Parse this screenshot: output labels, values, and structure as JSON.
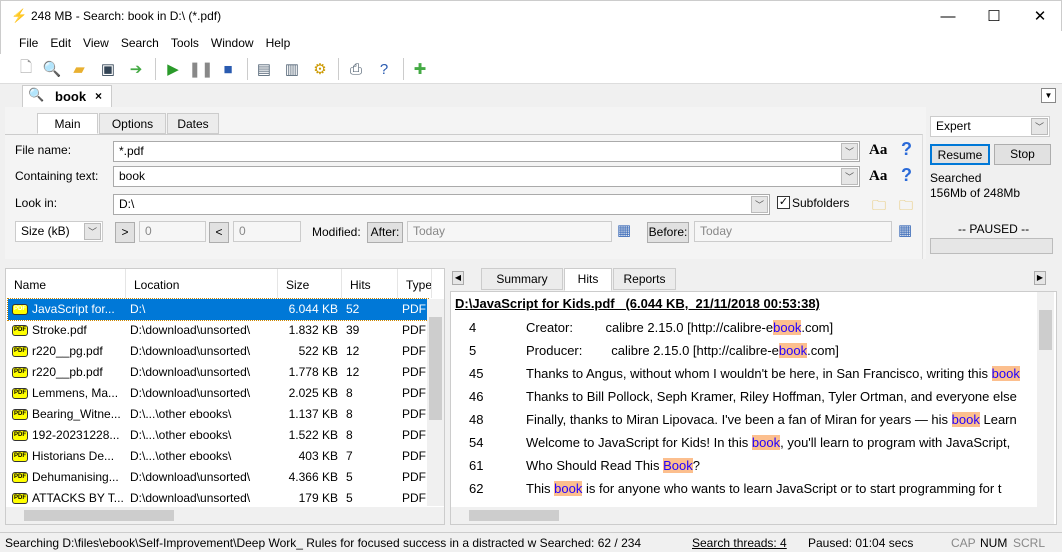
{
  "window": {
    "title": "248 MB - Search: book in D:\\ (*.pdf)",
    "minimize": "—",
    "maximize": "☐",
    "close": "✕"
  },
  "menu": [
    "File",
    "Edit",
    "View",
    "Search",
    "Tools",
    "Window",
    "Help"
  ],
  "toolbar": [
    "new-icon",
    "open-search-icon",
    "open-folder-icon",
    "save-icon",
    "export-icon",
    "start-icon",
    "pause-icon",
    "stop-icon",
    "view-icon",
    "layout-icon",
    "options-icon",
    "print-icon",
    "help-icon",
    "tools-add-icon"
  ],
  "doc_tab": {
    "label": "book",
    "close": "×"
  },
  "search_tabs": [
    "Main",
    "Options",
    "Dates"
  ],
  "form": {
    "file_name_label": "File name:",
    "file_name_value": "*.pdf",
    "containing_label": "Containing text:",
    "containing_value": "book",
    "look_in_label": "Look in:",
    "look_in_value": "D:\\",
    "subfolders_label": "Subfolders",
    "subfolders_checked": true,
    "size_select": "Size (kB)",
    "gt": ">",
    "gt_value": "0",
    "lt": "<",
    "lt_value": "0",
    "modified_label": "Modified:",
    "after_label": "After:",
    "after_value": "Today",
    "before_label": "Before:",
    "before_value": "Today",
    "case_label": "Aa",
    "help_label": "?"
  },
  "side": {
    "mode": "Expert",
    "resume": "Resume",
    "stop": "Stop",
    "searched_line1": "Searched",
    "searched_line2": "156Mb of 248Mb",
    "state": "-- PAUSED --"
  },
  "results": {
    "columns": [
      "Name",
      "Location",
      "Size",
      "Hits",
      "Type"
    ],
    "rows": [
      {
        "name": "JavaScript for...",
        "location": "D:\\",
        "size": "6.044 KB",
        "hits": "52",
        "type": "PDF"
      },
      {
        "name": "Stroke.pdf",
        "location": "D:\\download\\unsorted\\",
        "size": "1.832 KB",
        "hits": "39",
        "type": "PDF"
      },
      {
        "name": "r220__pg.pdf",
        "location": "D:\\download\\unsorted\\",
        "size": "522 KB",
        "hits": "12",
        "type": "PDF"
      },
      {
        "name": "r220__pb.pdf",
        "location": "D:\\download\\unsorted\\",
        "size": "1.778 KB",
        "hits": "12",
        "type": "PDF"
      },
      {
        "name": "Lemmens, Ma...",
        "location": "D:\\download\\unsorted\\",
        "size": "2.025 KB",
        "hits": "8",
        "type": "PDF"
      },
      {
        "name": "Bearing_Witne...",
        "location": "D:\\...\\other ebooks\\",
        "size": "1.137 KB",
        "hits": "8",
        "type": "PDF"
      },
      {
        "name": "192-20231228...",
        "location": "D:\\...\\other ebooks\\",
        "size": "1.522 KB",
        "hits": "8",
        "type": "PDF"
      },
      {
        "name": "Historians De...",
        "location": "D:\\...\\other ebooks\\",
        "size": "403 KB",
        "hits": "7",
        "type": "PDF"
      },
      {
        "name": "Dehumanising...",
        "location": "D:\\download\\unsorted\\",
        "size": "4.366 KB",
        "hits": "5",
        "type": "PDF"
      },
      {
        "name": "ATTACKS BY T...",
        "location": "D:\\download\\unsorted\\",
        "size": "179 KB",
        "hits": "5",
        "type": "PDF"
      }
    ]
  },
  "preview": {
    "tabs": [
      "Summary",
      "Hits",
      "Reports"
    ],
    "header": "D:\\JavaScript for Kids.pdf   (6.044 KB,  21/11/2018 00:53:38)",
    "lines": [
      {
        "n": "4",
        "pre": "Creator:         calibre 2.15.0 [http://calibre-e",
        "hit": "book",
        "post": ".com]"
      },
      {
        "n": "5",
        "pre": "Producer:        calibre 2.15.0 [http://calibre-e",
        "hit": "book",
        "post": ".com]"
      },
      {
        "n": "45",
        "pre": "Thanks to Angus, without whom I wouldn't be here, in San Francisco, writing this ",
        "hit": "book",
        "post": ""
      },
      {
        "n": "46",
        "pre": "Thanks to Bill Pollock, Seph Kramer, Riley Hoffman, Tyler Ortman, and everyone else",
        "hit": "",
        "post": ""
      },
      {
        "n": "48",
        "pre": "Finally, thanks to Miran Lipovaca. I've been a fan of Miran for years — his ",
        "hit": "book",
        "post": " Learn"
      },
      {
        "n": "54",
        "pre": "Welcome to JavaScript for Kids! In this ",
        "hit": "book",
        "post": ", you'll learn to program with JavaScript,"
      },
      {
        "n": "61",
        "pre": "Who Should Read This ",
        "hit": "Book",
        "post": "?"
      },
      {
        "n": "62",
        "pre": "This ",
        "hit": "book",
        "post": " is for anyone who wants to learn JavaScript or to start programming for t"
      }
    ]
  },
  "status": {
    "path": "Searching D:\\files\\ebook\\Self-Improvement\\Deep Work_ Rules for focused success in a distracted w Searched: 62 / 234",
    "threads": "Search threads: 4",
    "paused": "Paused: 01:04 secs",
    "cap": "CAP",
    "num": "NUM",
    "scrl": "SCRL"
  },
  "colors": {
    "selection": "#0078d7",
    "highlight": "#fcbf8e",
    "hit_text": "#2200ff"
  }
}
